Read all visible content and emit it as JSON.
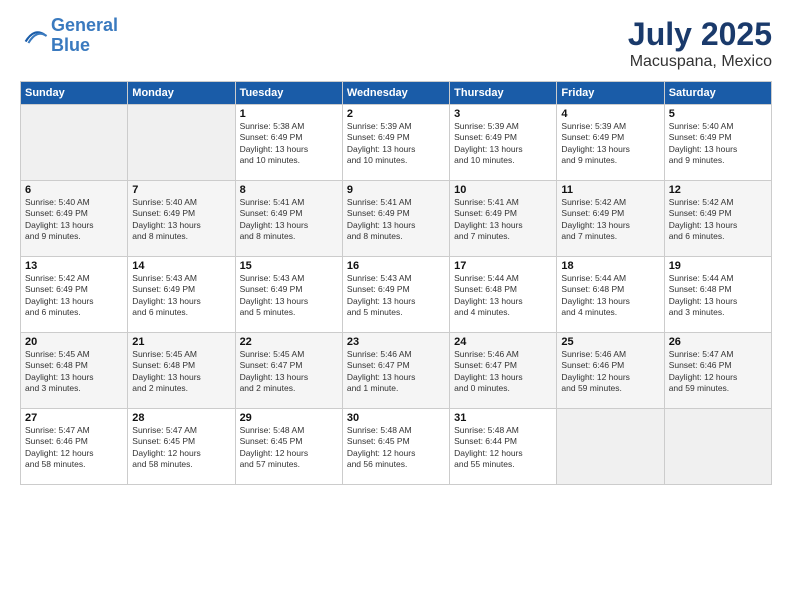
{
  "header": {
    "logo_line1": "General",
    "logo_line2": "Blue",
    "month": "July 2025",
    "location": "Macuspana, Mexico"
  },
  "calendar": {
    "days_of_week": [
      "Sunday",
      "Monday",
      "Tuesday",
      "Wednesday",
      "Thursday",
      "Friday",
      "Saturday"
    ],
    "weeks": [
      [
        {
          "day": "",
          "info": ""
        },
        {
          "day": "",
          "info": ""
        },
        {
          "day": "1",
          "info": "Sunrise: 5:38 AM\nSunset: 6:49 PM\nDaylight: 13 hours\nand 10 minutes."
        },
        {
          "day": "2",
          "info": "Sunrise: 5:39 AM\nSunset: 6:49 PM\nDaylight: 13 hours\nand 10 minutes."
        },
        {
          "day": "3",
          "info": "Sunrise: 5:39 AM\nSunset: 6:49 PM\nDaylight: 13 hours\nand 10 minutes."
        },
        {
          "day": "4",
          "info": "Sunrise: 5:39 AM\nSunset: 6:49 PM\nDaylight: 13 hours\nand 9 minutes."
        },
        {
          "day": "5",
          "info": "Sunrise: 5:40 AM\nSunset: 6:49 PM\nDaylight: 13 hours\nand 9 minutes."
        }
      ],
      [
        {
          "day": "6",
          "info": "Sunrise: 5:40 AM\nSunset: 6:49 PM\nDaylight: 13 hours\nand 9 minutes."
        },
        {
          "day": "7",
          "info": "Sunrise: 5:40 AM\nSunset: 6:49 PM\nDaylight: 13 hours\nand 8 minutes."
        },
        {
          "day": "8",
          "info": "Sunrise: 5:41 AM\nSunset: 6:49 PM\nDaylight: 13 hours\nand 8 minutes."
        },
        {
          "day": "9",
          "info": "Sunrise: 5:41 AM\nSunset: 6:49 PM\nDaylight: 13 hours\nand 8 minutes."
        },
        {
          "day": "10",
          "info": "Sunrise: 5:41 AM\nSunset: 6:49 PM\nDaylight: 13 hours\nand 7 minutes."
        },
        {
          "day": "11",
          "info": "Sunrise: 5:42 AM\nSunset: 6:49 PM\nDaylight: 13 hours\nand 7 minutes."
        },
        {
          "day": "12",
          "info": "Sunrise: 5:42 AM\nSunset: 6:49 PM\nDaylight: 13 hours\nand 6 minutes."
        }
      ],
      [
        {
          "day": "13",
          "info": "Sunrise: 5:42 AM\nSunset: 6:49 PM\nDaylight: 13 hours\nand 6 minutes."
        },
        {
          "day": "14",
          "info": "Sunrise: 5:43 AM\nSunset: 6:49 PM\nDaylight: 13 hours\nand 6 minutes."
        },
        {
          "day": "15",
          "info": "Sunrise: 5:43 AM\nSunset: 6:49 PM\nDaylight: 13 hours\nand 5 minutes."
        },
        {
          "day": "16",
          "info": "Sunrise: 5:43 AM\nSunset: 6:49 PM\nDaylight: 13 hours\nand 5 minutes."
        },
        {
          "day": "17",
          "info": "Sunrise: 5:44 AM\nSunset: 6:48 PM\nDaylight: 13 hours\nand 4 minutes."
        },
        {
          "day": "18",
          "info": "Sunrise: 5:44 AM\nSunset: 6:48 PM\nDaylight: 13 hours\nand 4 minutes."
        },
        {
          "day": "19",
          "info": "Sunrise: 5:44 AM\nSunset: 6:48 PM\nDaylight: 13 hours\nand 3 minutes."
        }
      ],
      [
        {
          "day": "20",
          "info": "Sunrise: 5:45 AM\nSunset: 6:48 PM\nDaylight: 13 hours\nand 3 minutes."
        },
        {
          "day": "21",
          "info": "Sunrise: 5:45 AM\nSunset: 6:48 PM\nDaylight: 13 hours\nand 2 minutes."
        },
        {
          "day": "22",
          "info": "Sunrise: 5:45 AM\nSunset: 6:47 PM\nDaylight: 13 hours\nand 2 minutes."
        },
        {
          "day": "23",
          "info": "Sunrise: 5:46 AM\nSunset: 6:47 PM\nDaylight: 13 hours\nand 1 minute."
        },
        {
          "day": "24",
          "info": "Sunrise: 5:46 AM\nSunset: 6:47 PM\nDaylight: 13 hours\nand 0 minutes."
        },
        {
          "day": "25",
          "info": "Sunrise: 5:46 AM\nSunset: 6:46 PM\nDaylight: 12 hours\nand 59 minutes."
        },
        {
          "day": "26",
          "info": "Sunrise: 5:47 AM\nSunset: 6:46 PM\nDaylight: 12 hours\nand 59 minutes."
        }
      ],
      [
        {
          "day": "27",
          "info": "Sunrise: 5:47 AM\nSunset: 6:46 PM\nDaylight: 12 hours\nand 58 minutes."
        },
        {
          "day": "28",
          "info": "Sunrise: 5:47 AM\nSunset: 6:45 PM\nDaylight: 12 hours\nand 58 minutes."
        },
        {
          "day": "29",
          "info": "Sunrise: 5:48 AM\nSunset: 6:45 PM\nDaylight: 12 hours\nand 57 minutes."
        },
        {
          "day": "30",
          "info": "Sunrise: 5:48 AM\nSunset: 6:45 PM\nDaylight: 12 hours\nand 56 minutes."
        },
        {
          "day": "31",
          "info": "Sunrise: 5:48 AM\nSunset: 6:44 PM\nDaylight: 12 hours\nand 55 minutes."
        },
        {
          "day": "",
          "info": ""
        },
        {
          "day": "",
          "info": ""
        }
      ]
    ]
  }
}
